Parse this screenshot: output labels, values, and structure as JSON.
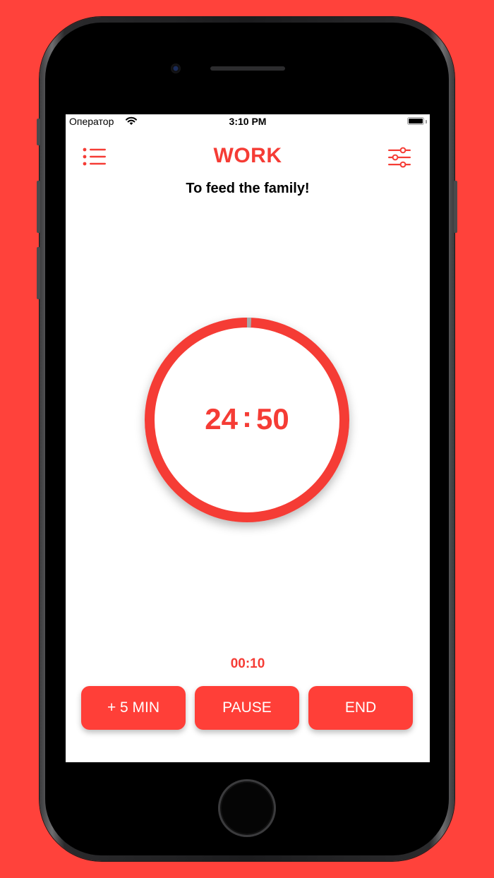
{
  "status_bar": {
    "carrier": "Оператор",
    "time": "3:10 PM"
  },
  "header": {
    "mode_title": "WORK",
    "task_subtitle": "To feed the family!",
    "menu_icon": "list-icon",
    "settings_icon": "sliders-icon"
  },
  "timer": {
    "minutes": "24",
    "separator": ":",
    "seconds": "50",
    "progress_fraction": 0.0067
  },
  "elapsed": "00:10",
  "buttons": {
    "add_label": "+ 5 MIN",
    "pause_label": "PAUSE",
    "end_label": "END"
  },
  "colors": {
    "accent": "#f53c35",
    "background": "#ff423b",
    "ring_elapsed": "#a8a8a8"
  }
}
